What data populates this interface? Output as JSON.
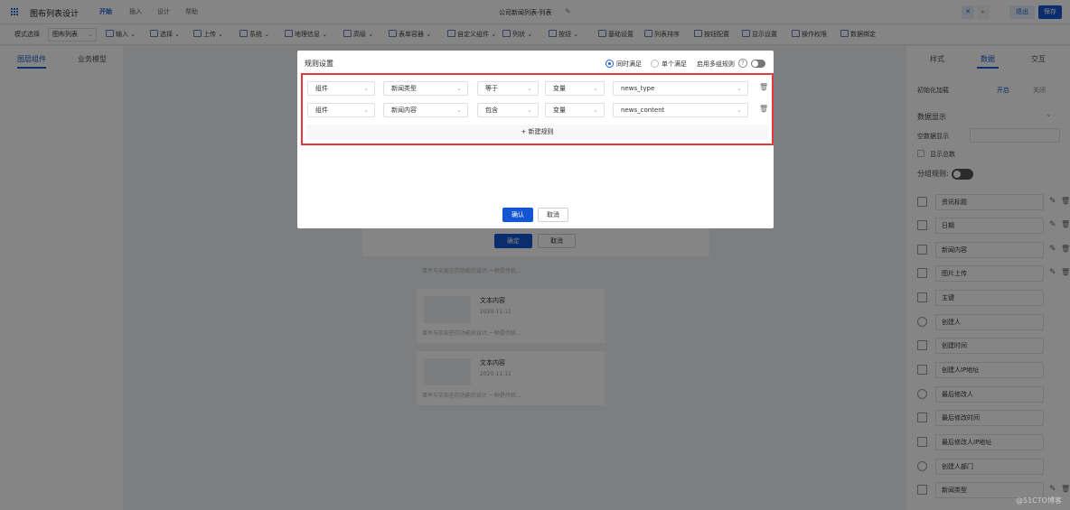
{
  "app": {
    "title": "图布列表设计"
  },
  "menu": [
    "开始",
    "插入",
    "设计",
    "帮助"
  ],
  "doc_title": "公司新闻列表-列表",
  "top_right": {
    "exit": "退出",
    "save": "保存"
  },
  "toolbar": {
    "mode_label": "模式选择",
    "mode_value": "图布列表",
    "items": [
      "输入",
      "选择",
      "上传",
      "系统",
      "地理信息",
      "高级",
      "表单容器",
      "自定义组件",
      "列状",
      "按钮",
      "基础设置",
      "列表排序",
      "按钮配置",
      "显示设置",
      "操作权限",
      "数据绑定"
    ]
  },
  "left_panel": {
    "tabs": [
      "图层组件",
      "业务模型"
    ]
  },
  "right_panel": {
    "tabs": [
      "样式",
      "数据",
      "交互"
    ],
    "init_load_label": "初始化加载",
    "init_on": "开启",
    "init_off": "关闭",
    "data_display": "数据显示",
    "empty_display": "空数据显示",
    "show_total": "显示总数",
    "group_rule": "分组规则:",
    "fields": [
      {
        "label": "资讯标题",
        "icon": "text-field-icon",
        "edit": true
      },
      {
        "label": "日期",
        "icon": "date-field-icon",
        "edit": true
      },
      {
        "label": "新闻内容",
        "icon": "text-field-icon",
        "edit": true
      },
      {
        "label": "图片上传",
        "icon": "image-field-icon",
        "edit": true
      },
      {
        "label": "主键",
        "icon": "text-field-icon",
        "edit": false
      },
      {
        "label": "创建人",
        "icon": "user-field-icon",
        "edit": false
      },
      {
        "label": "创建时间",
        "icon": "date-field-icon",
        "edit": false
      },
      {
        "label": "创建人IP地址",
        "icon": "text-field-icon",
        "edit": false
      },
      {
        "label": "最后修改人",
        "icon": "user-field-icon",
        "edit": false
      },
      {
        "label": "最后修改时间",
        "icon": "date-field-icon",
        "edit": false
      },
      {
        "label": "最后修改人IP地址",
        "icon": "text-field-icon",
        "edit": false
      },
      {
        "label": "创建人部门",
        "icon": "dept-field-icon",
        "edit": false
      },
      {
        "label": "新闻类型",
        "icon": "select-field-icon",
        "edit": true
      }
    ]
  },
  "canvas": {
    "bg_dialog": {
      "confirm": "确定",
      "cancel": "取消"
    },
    "cards": [
      {
        "title": "文本内容",
        "date": "2020-11-11",
        "text": "事件与实现在的功能的设计,一种是传统..."
      },
      {
        "title": "文本内容",
        "date": "2020-11-11",
        "text": "事件与实现在的功能的设计,一种是传统..."
      }
    ],
    "card_top_text": "事件与实现在的功能的设计,一种是传统..."
  },
  "dialog": {
    "title": "规则设置",
    "radio_all": "同时满足",
    "radio_single": "单个满足",
    "multi_group": "启用多组规则",
    "rules": [
      {
        "type": "组件",
        "field": "新闻类型",
        "op": "等于",
        "value_type": "变量",
        "value": "news_type"
      },
      {
        "type": "组件",
        "field": "新闻内容",
        "op": "包含",
        "value_type": "变量",
        "value": "news_content"
      }
    ],
    "add_rule": "新建规则",
    "confirm": "确认",
    "cancel": "取消"
  },
  "watermark": "@51CTO博客"
}
